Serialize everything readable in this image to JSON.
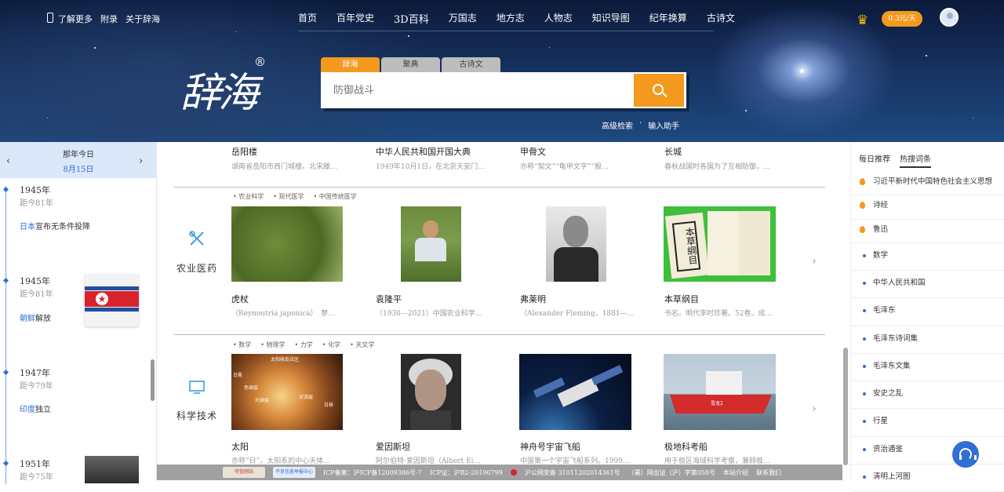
{
  "topbar": {
    "links": [
      "了解更多",
      "附录",
      "关于辞海"
    ]
  },
  "nav": {
    "items": [
      "首页",
      "百年党史",
      "3D百科",
      "万国志",
      "地方志",
      "人物志",
      "知识导图",
      "纪年换算",
      "古诗文"
    ]
  },
  "user": {
    "price": "0.3元/天"
  },
  "logo": {
    "text": "辞海",
    "reg": "®"
  },
  "search": {
    "tabs": [
      "辞海",
      "聚典",
      "古诗文"
    ],
    "placeholder": "防御战斗",
    "links": [
      "高级检索",
      "输入助手"
    ]
  },
  "today": {
    "title": "那年今日",
    "date": "8月15日",
    "events": [
      {
        "year": "1945年",
        "ago": "距今81年",
        "link": "日本",
        "text": "宣布无条件投降"
      },
      {
        "year": "1945年",
        "ago": "距今81年",
        "link": "朝鲜",
        "text": "解放"
      },
      {
        "year": "1947年",
        "ago": "距今79年",
        "link": "印度",
        "text": "独立"
      },
      {
        "year": "1951年",
        "ago": "距今75年",
        "link": "",
        "text": ""
      }
    ]
  },
  "top_row": [
    {
      "title": "岳阳楼",
      "desc": "湖南省岳阳市西门城楼。北宋滕…"
    },
    {
      "title": "中华人民共和国开国大典",
      "desc": "1949年10月1日，在北京天安门…"
    },
    {
      "title": "甲骨文",
      "desc": "亦称“契文”“龟甲文字”“殷…"
    },
    {
      "title": "长城",
      "desc": "春秋战国时各国为了互相防御，…"
    }
  ],
  "sections": [
    {
      "name": "农业医药",
      "tags": [
        "农业科学",
        "现代医学",
        "中国传统医学"
      ],
      "cards": [
        {
          "title": "虎杖",
          "desc": "（Reynoutria japonica）　蓼…"
        },
        {
          "title": "袁隆平",
          "desc": "（1930—2021）中国农业科学…"
        },
        {
          "title": "弗莱明",
          "desc": "（Alexander Fleming，1881—…"
        },
        {
          "title": "本草纲目",
          "desc": "书名。明代李时珍著。52卷。成…"
        }
      ]
    },
    {
      "name": "科学技术",
      "tags": [
        "数学",
        "物理学",
        "力学",
        "化学",
        "天文学"
      ],
      "cards": [
        {
          "title": "太阳",
          "desc": "亦称“日”。太阳系的中心天体…"
        },
        {
          "title": "爱因斯坦",
          "desc": "阿尔伯特·爱因斯坦（Albert Ei…"
        },
        {
          "title": "神舟号宇宙飞船",
          "desc": "中国第一个宇宙飞船系列。1999…"
        },
        {
          "title": "极地科考船",
          "desc": "用于极区海域科学考察，兼顾极…"
        }
      ]
    }
  ],
  "images": {
    "sun_label": "太阳核反应区",
    "sun_text_1": "日冕",
    "sun_text_2": "色球层",
    "sun_text_3": "光球层",
    "sun_text_4": "对流层",
    "sun_text_5": "日核",
    "book_title": "本草綱目",
    "ship_text": "雪龙2"
  },
  "footer": {
    "badge1": "可信网站",
    "badge2": "不良信息举报中心",
    "items": [
      "ICP备案：沪ICP备12009386号-7",
      "ICP证：沪B2-20190799",
      "沪公网安备 31011202014361号",
      "（署）网出证（沪）字第058号",
      "本站介绍",
      "联系我们"
    ]
  },
  "right": {
    "tabs": [
      "每日推荐",
      "热搜词条"
    ],
    "hot": [
      "习近平新时代中国特色社会主义思想",
      "诗经",
      "鲁迅"
    ],
    "list": [
      "数学",
      "中华人民共和国",
      "毛泽东",
      "毛泽东诗词集",
      "毛泽东文集",
      "安史之乱",
      "行星",
      "资治通鉴",
      "清明上河图"
    ]
  },
  "colors": {
    "accent": "#f39a1e",
    "link": "#2f6fd6",
    "date_bg": "#dbe8fa"
  }
}
